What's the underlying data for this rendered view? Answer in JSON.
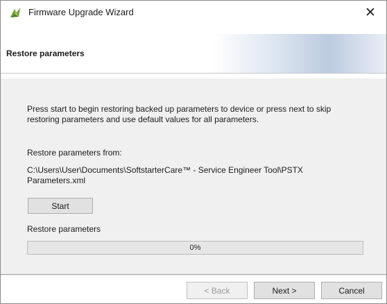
{
  "window": {
    "title": "Firmware Upgrade Wizard",
    "app_icon": "wizard-app-icon",
    "close_glyph": "✕"
  },
  "header": {
    "title": "Restore parameters"
  },
  "body": {
    "description": "Press start to begin restoring backed up parameters to device or press next to skip restoring parameters and use default values for all parameters.",
    "from_label": "Restore parameters from:",
    "path": "C:\\Users\\User\\Documents\\SoftstarterCare™ - Service Engineer Tool\\PSTX Parameters.xml",
    "start_label": "Start",
    "progress_label": "Restore parameters",
    "progress_text": "0%",
    "progress_fraction": 0
  },
  "footer": {
    "back_label": "< Back",
    "back_enabled": false,
    "next_label": "Next >",
    "cancel_label": "Cancel"
  },
  "colors": {
    "progress_fill": "#06b025",
    "header_gradient": "#bccbe0",
    "body_background": "#f0f0f0"
  }
}
